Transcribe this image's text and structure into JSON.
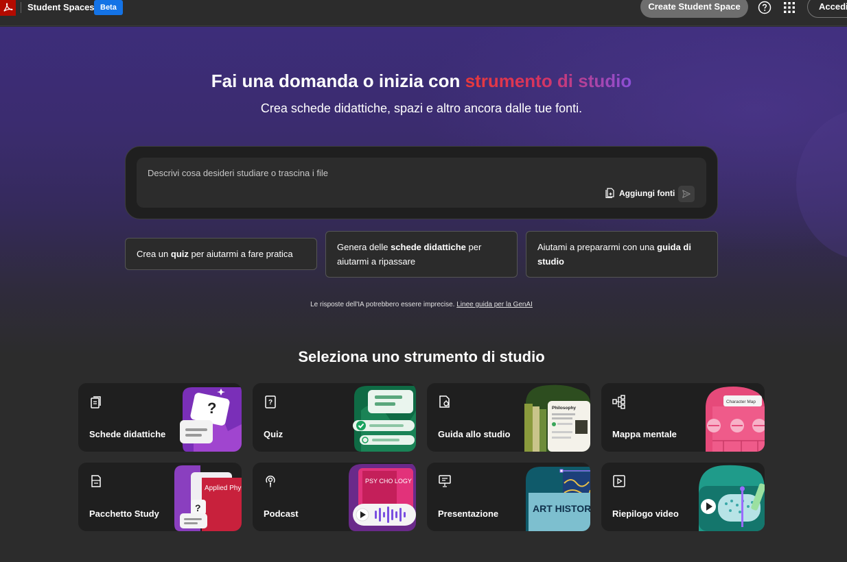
{
  "header": {
    "app_name": "Student Spaces",
    "beta_badge": "Beta",
    "create_button": "Create Student Space",
    "sign_in_button": "Accedi",
    "logo_icon": "adobe-acrobat-logo",
    "help_icon": "help-circle-icon",
    "apps_icon": "app-grid-icon"
  },
  "hero": {
    "headline_prefix": "Fai una domanda o inizia con ",
    "headline_accent": "strumento di studio",
    "subheadline": "Crea schede didattiche, spazi e altro ancora dalle tue fonti."
  },
  "prompt": {
    "placeholder": "Descrivi cosa desideri studiare o trascina i file",
    "add_sources_label": "Aggiungi fonti",
    "add_sources_icon": "add-file-icon",
    "send_icon": "send-icon"
  },
  "suggestions": [
    {
      "pre": "Crea un ",
      "bold": "quiz",
      "post": " per aiutarmi a fare pratica"
    },
    {
      "pre": "Genera delle ",
      "bold": "schede didattiche",
      "post": " per aiutarmi a ripassare"
    },
    {
      "pre": "Aiutami a prepararmi con una ",
      "bold": "guida di studio",
      "post": ""
    }
  ],
  "disclaimer": {
    "text": "Le risposte dell'IA potrebbero essere imprecise. ",
    "link": "Linee guida per la GenAI"
  },
  "tools": {
    "title": "Seleziona uno strumento di studio",
    "items": [
      {
        "label": "Schede didattiche",
        "icon": "flashcards-icon"
      },
      {
        "label": "Quiz",
        "icon": "quiz-icon"
      },
      {
        "label": "Guida allo studio",
        "icon": "study-guide-icon"
      },
      {
        "label": "Mappa mentale",
        "icon": "mind-map-icon"
      },
      {
        "label": "Pacchetto Study",
        "icon": "study-pack-icon"
      },
      {
        "label": "Podcast",
        "icon": "podcast-icon"
      },
      {
        "label": "Presentazione",
        "icon": "presentation-icon"
      },
      {
        "label": "Riepilogo video",
        "icon": "video-summary-icon"
      }
    ],
    "art_text": {
      "philosophy": "Philosophy",
      "character_map": "Character Map",
      "applied_physics": "Applied Physics",
      "psychology": "PSY CHO LOGY",
      "art_history": "ART HISTORY"
    }
  }
}
